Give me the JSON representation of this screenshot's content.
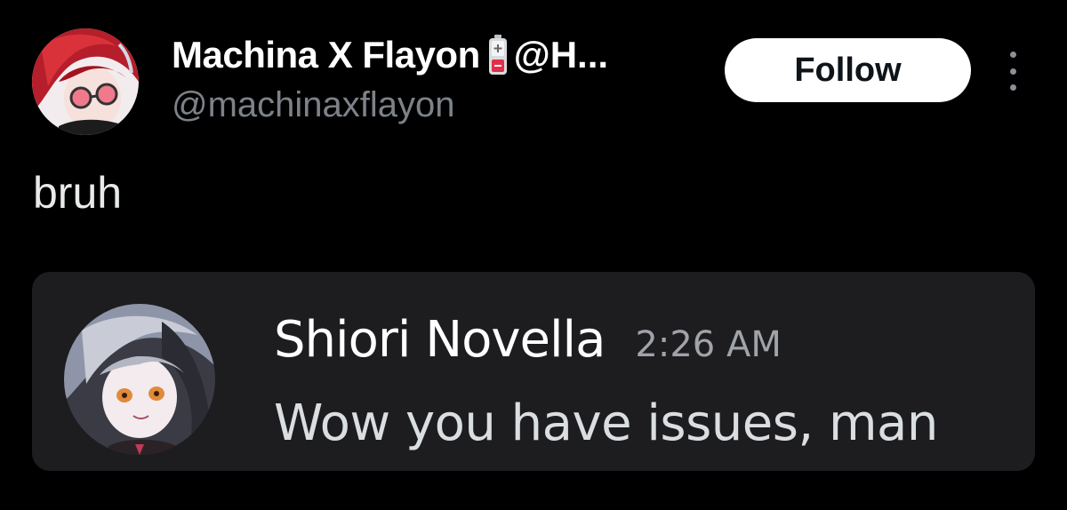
{
  "post": {
    "author": {
      "display_name": "Machina X Flayon",
      "name_suffix": "@H...",
      "handle": "@machinaxflayon",
      "avatar_icon": "avatar-red-hair-glasses",
      "badge_icon": "battery-icon"
    },
    "follow_label": "Follow",
    "more_icon": "more-vertical-icon",
    "text": "bruh"
  },
  "embed": {
    "author": "Shiori Novella",
    "time": "2:26 AM",
    "message": "Wow you have issues, man",
    "avatar_icon": "avatar-silver-hair"
  },
  "colors": {
    "background": "#000000",
    "card_background": "#1d1d20",
    "handle_gray": "#7d8288",
    "button_bg": "#ffffff",
    "battery_red": "#e0304a"
  }
}
